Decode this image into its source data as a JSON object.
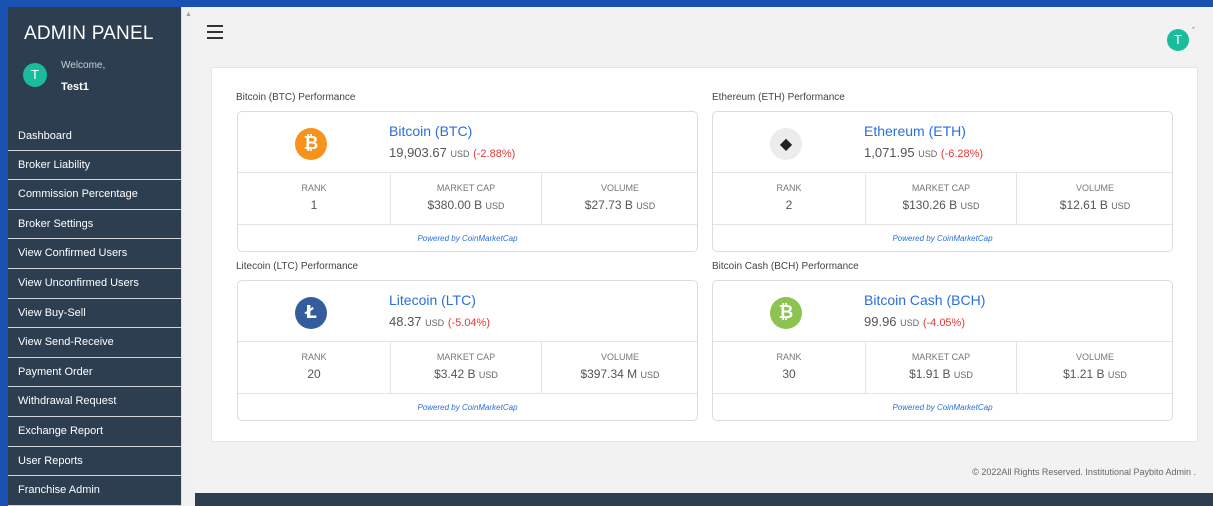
{
  "sidebar": {
    "brand": "ADMIN PANEL",
    "avatar_initial": "T",
    "welcome": "Welcome,",
    "username": "Test1",
    "items": [
      {
        "label": "Dashboard"
      },
      {
        "label": "Broker Liability"
      },
      {
        "label": "Commission Percentage"
      },
      {
        "label": "Broker Settings"
      },
      {
        "label": "View Confirmed Users"
      },
      {
        "label": "View Unconfirmed Users"
      },
      {
        "label": "View Buy-Sell"
      },
      {
        "label": "View Send-Receive"
      },
      {
        "label": "Payment Order"
      },
      {
        "label": "Withdrawal Request"
      },
      {
        "label": "Exchange Report"
      },
      {
        "label": "User Reports"
      },
      {
        "label": "Franchise Admin"
      }
    ]
  },
  "header": {
    "avatar_initial": "T",
    "caret": "ˇ"
  },
  "coins": [
    {
      "section_title": "Bitcoin (BTC) Performance",
      "name": "Bitcoin (BTC)",
      "price": "19,903.67",
      "price_unit": "USD",
      "change": "(-2.88%)",
      "icon": "bitcoin-icon",
      "icon_glyph": "₿",
      "icon_color": "#f7931a",
      "rank_label": "RANK",
      "rank": "1",
      "cap_label": "MARKET CAP",
      "cap": "$380.00 B",
      "cap_unit": "USD",
      "vol_label": "VOLUME",
      "vol": "$27.73 B",
      "vol_unit": "USD",
      "powered": "Powered by CoinMarketCap"
    },
    {
      "section_title": "Ethereum (ETH) Performance",
      "name": "Ethereum (ETH)",
      "price": "1,071.95",
      "price_unit": "USD",
      "change": "(-6.28%)",
      "icon": "ethereum-icon",
      "icon_glyph": "◆",
      "icon_color": "#ececec",
      "rank_label": "RANK",
      "rank": "2",
      "cap_label": "MARKET CAP",
      "cap": "$130.26 B",
      "cap_unit": "USD",
      "vol_label": "VOLUME",
      "vol": "$12.61 B",
      "vol_unit": "USD",
      "powered": "Powered by CoinMarketCap"
    },
    {
      "section_title": "Litecoin (LTC) Performance",
      "name": "Litecoin (LTC)",
      "price": "48.37",
      "price_unit": "USD",
      "change": "(-5.04%)",
      "icon": "litecoin-icon",
      "icon_glyph": "Ł",
      "icon_color": "#345d9d",
      "rank_label": "RANK",
      "rank": "20",
      "cap_label": "MARKET CAP",
      "cap": "$3.42 B",
      "cap_unit": "USD",
      "vol_label": "VOLUME",
      "vol": "$397.34 M",
      "vol_unit": "USD",
      "powered": "Powered by CoinMarketCap"
    },
    {
      "section_title": "Bitcoin Cash (BCH) Performance",
      "name": "Bitcoin Cash (BCH)",
      "price": "99.96",
      "price_unit": "USD",
      "change": "(-4.05%)",
      "icon": "bitcoin-cash-icon",
      "icon_glyph": "₿",
      "icon_color": "#8dc351",
      "rank_label": "RANK",
      "rank": "30",
      "cap_label": "MARKET CAP",
      "cap": "$1.91 B",
      "cap_unit": "USD",
      "vol_label": "VOLUME",
      "vol": "$1.21 B",
      "vol_unit": "USD",
      "powered": "Powered by CoinMarketCap"
    }
  ],
  "footer": {
    "text": "© 2022All Rights Reserved. Institutional Paybito Admin ."
  },
  "colors": {
    "sidebar_bg": "#2c3e50",
    "accent": "#1a52b4",
    "avatar": "#1abc9c",
    "link": "#2a6fdb",
    "negative": "#e53935"
  }
}
